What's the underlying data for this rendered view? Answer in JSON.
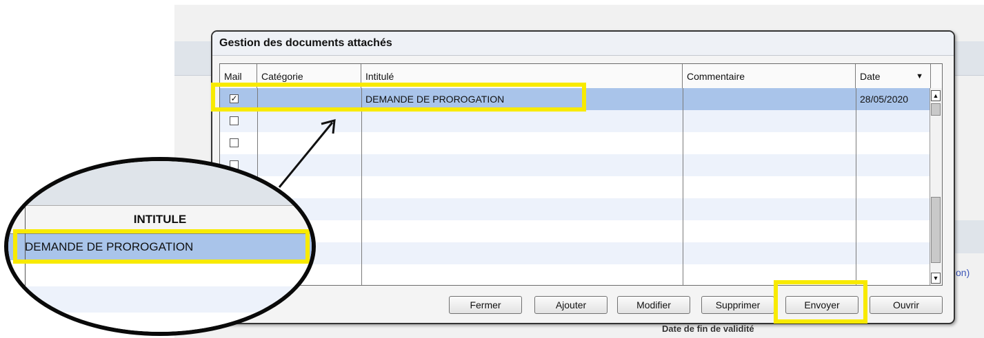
{
  "background": {
    "partial_link": "on)",
    "bottom_text": "Date de fin de validité"
  },
  "dialog": {
    "title": "Gestion des documents attachés",
    "columns": [
      "Mail",
      "Catégorie",
      "Intitulé",
      "Commentaire",
      "Date"
    ],
    "sort_indicator": "▼",
    "rows": [
      {
        "mail": true,
        "categorie": "",
        "intitule": "DEMANDE DE PROROGATION",
        "commentaire": "",
        "date": "28/05/2020",
        "selected": true
      },
      {
        "mail": false,
        "categorie": "",
        "intitule": "",
        "commentaire": "",
        "date": "",
        "selected": false
      },
      {
        "mail": false,
        "categorie": "",
        "intitule": "",
        "commentaire": "",
        "date": "",
        "selected": false
      },
      {
        "mail": false,
        "categorie": "",
        "intitule": "",
        "commentaire": "",
        "date": "",
        "selected": false
      },
      {
        "mail": false,
        "categorie": "",
        "intitule": "",
        "commentaire": "",
        "date": "",
        "selected": false
      },
      {
        "mail": false,
        "categorie": "",
        "intitule": "",
        "commentaire": "",
        "date": "",
        "selected": false
      },
      {
        "mail": false,
        "categorie": "",
        "intitule": "",
        "commentaire": "",
        "date": "",
        "selected": false
      },
      {
        "mail": false,
        "categorie": "",
        "intitule": "",
        "commentaire": "",
        "date": "",
        "selected": false
      },
      {
        "mail": false,
        "categorie": "",
        "intitule": "",
        "commentaire": "",
        "date": "",
        "selected": false
      }
    ],
    "buttons": [
      "Fermer",
      "Ajouter",
      "Modifier",
      "Supprimer",
      "Envoyer",
      "Ouvrir"
    ],
    "scroll_up": "▲",
    "scroll_down": "▼"
  },
  "zoom": {
    "header": "INTITULE",
    "selected_value": "DEMANDE DE PROROGATION"
  },
  "colors": {
    "highlight": "#f8ea00",
    "selection": "#a9c4ea"
  }
}
